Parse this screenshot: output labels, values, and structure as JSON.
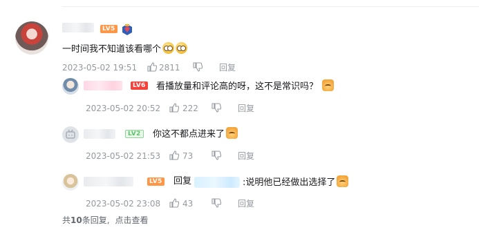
{
  "main_comment": {
    "text": "一时间我不知道该看哪个",
    "level": "LV5",
    "time": "2023-05-02 19:51",
    "likes": "2811",
    "reply_label": "回复",
    "emojis": [
      "sun-eyes-emoji",
      "sun-eyes-emoji"
    ]
  },
  "replies": [
    {
      "level": "LV6",
      "text": "看播放量和评论高的呀，这不是常识吗？",
      "time": "2023-05-02 20:52",
      "likes": "222",
      "reply_label": "回复"
    },
    {
      "level": "LV2",
      "text": "你这不都点进来了",
      "time": "2023-05-02 21:53",
      "likes": "73",
      "reply_label": "回复"
    },
    {
      "level": "LV5",
      "reply_prefix": "回复",
      "text": ":说明他已经做出选择了",
      "time": "2023-05-02 23:08",
      "likes": "43",
      "reply_label": "回复"
    }
  ],
  "footer": {
    "prefix": "共",
    "count": "10",
    "suffix": "条回复,",
    "view_more": "点击查看"
  },
  "colors": {
    "meta_gray": "#9499a0",
    "lv5_orange": "#ff9648",
    "lv6_red": "#f4423d",
    "lv2_green": "#5fbf6a"
  }
}
